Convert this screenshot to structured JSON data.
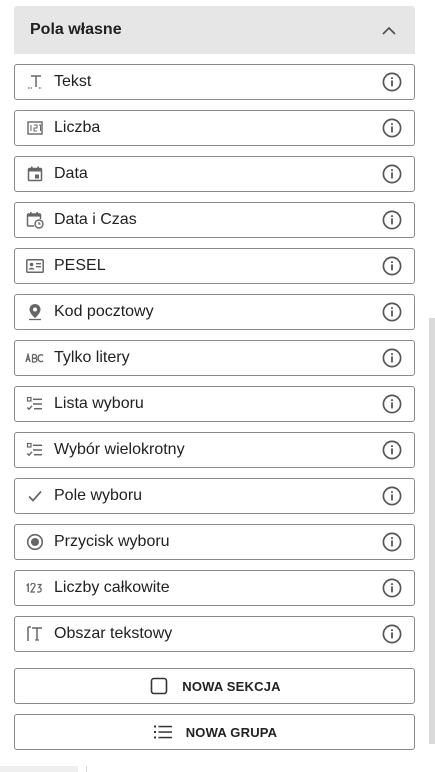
{
  "section": {
    "title": "Pola własne",
    "collapse_icon": "chevron-up-icon"
  },
  "fields": [
    {
      "label": "Tekst",
      "icon": "text-field-icon"
    },
    {
      "label": "Liczba",
      "icon": "number-field-icon"
    },
    {
      "label": "Data",
      "icon": "calendar-icon"
    },
    {
      "label": "Data i Czas",
      "icon": "calendar-clock-icon"
    },
    {
      "label": "PESEL",
      "icon": "id-card-icon"
    },
    {
      "label": "Kod pocztowy",
      "icon": "location-pin-icon"
    },
    {
      "label": "Tylko litery",
      "icon": "abc-icon"
    },
    {
      "label": "Lista wyboru",
      "icon": "checklist-icon"
    },
    {
      "label": "Wybór wielokrotny",
      "icon": "checklist-icon"
    },
    {
      "label": "Pole wyboru",
      "icon": "checkmark-icon"
    },
    {
      "label": "Przycisk wyboru",
      "icon": "radio-button-icon"
    },
    {
      "label": "Liczby całkowite",
      "icon": "digits-123-icon"
    },
    {
      "label": "Obszar tekstowy",
      "icon": "text-area-icon"
    }
  ],
  "info_icon": "info-circle-icon",
  "actions": {
    "new_section": {
      "label": "NOWA SEKCJA",
      "icon": "square-outline-icon"
    },
    "new_group": {
      "label": "NOWA GRUPA",
      "icon": "list-icon"
    }
  },
  "colors": {
    "header_bg": "#e6e6e6",
    "border": "#8a8a8a",
    "icon_gray": "#666666",
    "text": "#212121"
  }
}
